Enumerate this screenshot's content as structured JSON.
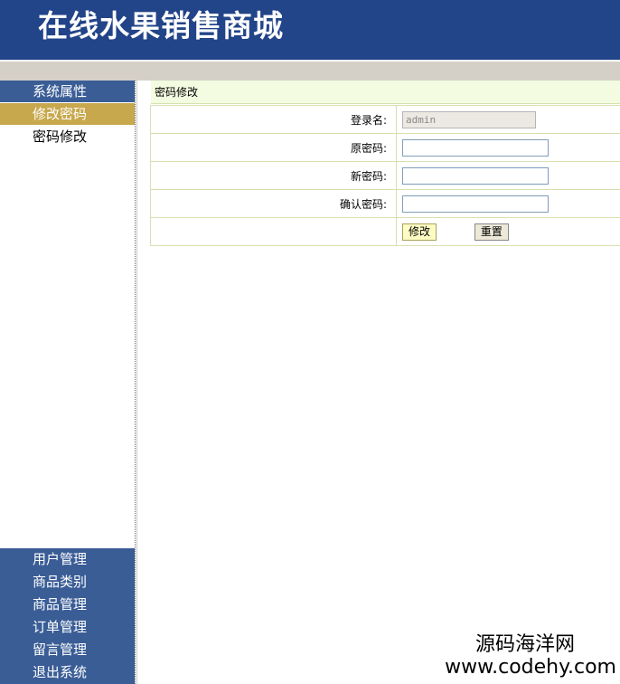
{
  "header": {
    "title": "在线水果销售商城"
  },
  "sidebar": {
    "section_title": "系统属性",
    "items": [
      {
        "label": "修改密码"
      },
      {
        "label": "密码修改"
      }
    ],
    "bottom_menu": [
      {
        "label": "用户管理"
      },
      {
        "label": "商品类别"
      },
      {
        "label": "商品管理"
      },
      {
        "label": "订单管理"
      },
      {
        "label": "留言管理"
      },
      {
        "label": "退出系统"
      }
    ]
  },
  "main": {
    "title": "密码修改",
    "form": {
      "username_label": "登录名:",
      "username_value": "admin",
      "old_password_label": "原密码:",
      "new_password_label": "新密码:",
      "confirm_password_label": "确认密码:",
      "submit_label": "修改",
      "reset_label": "重置"
    }
  },
  "watermark": {
    "line1": "源码海洋网",
    "line2": "www.codehy.com"
  },
  "colors": {
    "header_bg": "#224488",
    "menu_bg": "#3a5d96",
    "active_item_bg": "#c8a84c"
  }
}
